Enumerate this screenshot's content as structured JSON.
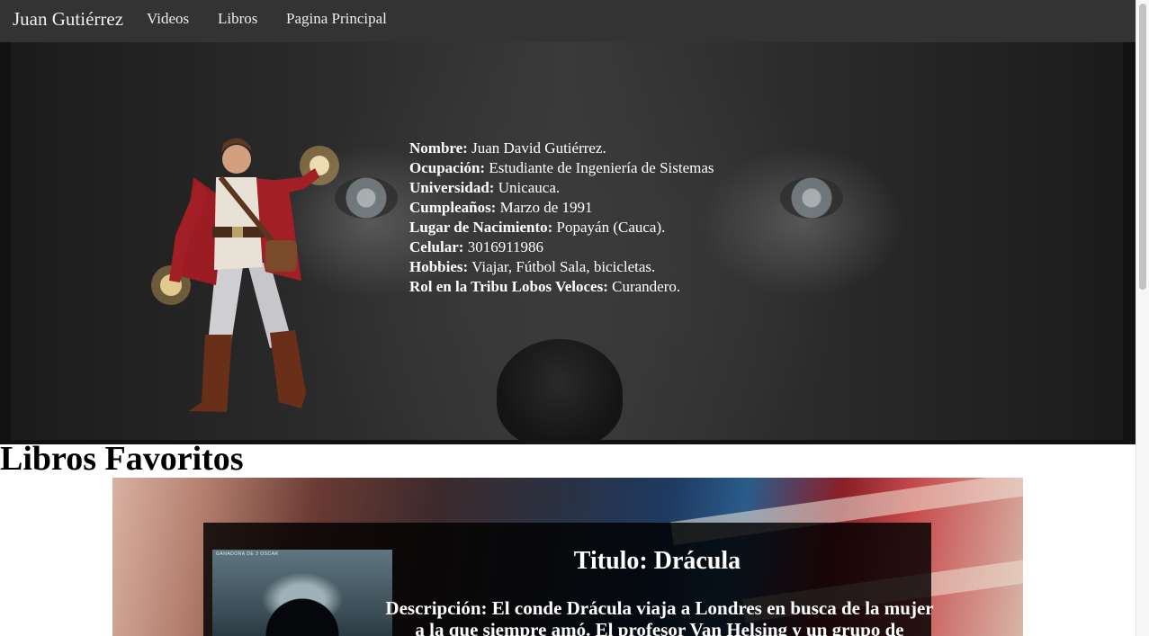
{
  "nav": {
    "brand": "Juan Gutiérrez",
    "links": [
      "Videos",
      "Libros",
      "Pagina Principal"
    ]
  },
  "profile": {
    "rows": [
      {
        "label": "Nombre:",
        "value": " Juan David Gutiérrez."
      },
      {
        "label": "Ocupación:",
        "value": " Estudiante de Ingeniería de Sistemas"
      },
      {
        "label": "Universidad:",
        "value": " Unicauca."
      },
      {
        "label": "Cumpleaños:",
        "value": " Marzo de 1991"
      },
      {
        "label": "Lugar de Nacimiento:",
        "value": " Popayán (Cauca)."
      },
      {
        "label": "Celular:",
        "value": " 3016911986"
      },
      {
        "label": "Hobbies:",
        "value": " Viajar, Fútbol Sala, bicicletas."
      },
      {
        "label": "Rol en la Tribu Lobos Veloces:",
        "value": " Curandero."
      }
    ]
  },
  "books": {
    "section_title": "Libros Favoritos",
    "items": [
      {
        "title": "Titulo: Drácula",
        "cover_caption": "GANADORA DE 3 OSCAR",
        "description": "Descripción: El conde Drácula viaja a Londres en busca de la mujer a la que siempre amó. El profesor Van Helsing y un grupo de"
      }
    ]
  },
  "colors": {
    "navbar": "#333333",
    "nav_text": "#eeeeee",
    "hero_text": "#ffffff",
    "card_bg": "#000000"
  }
}
